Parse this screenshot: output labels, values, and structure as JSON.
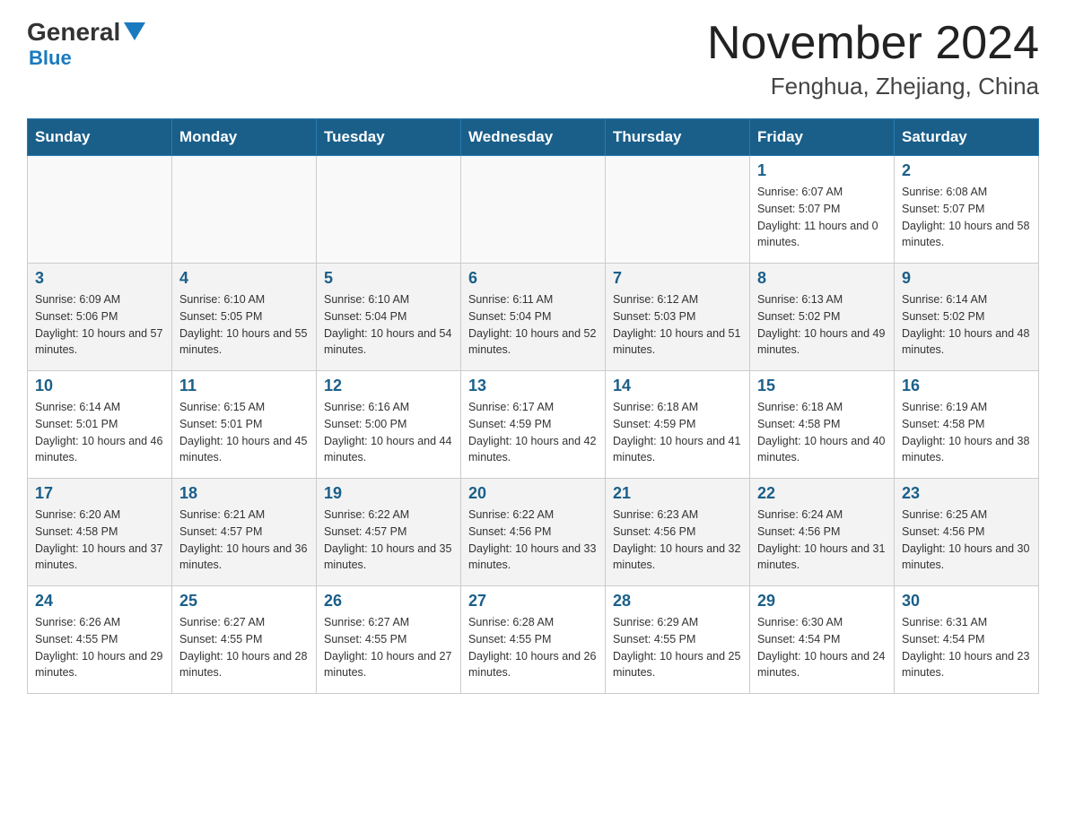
{
  "header": {
    "logo_general": "General",
    "logo_blue": "Blue",
    "title": "November 2024",
    "subtitle": "Fenghua, Zhejiang, China"
  },
  "days_of_week": [
    "Sunday",
    "Monday",
    "Tuesday",
    "Wednesday",
    "Thursday",
    "Friday",
    "Saturday"
  ],
  "weeks": [
    [
      {
        "day": "",
        "info": ""
      },
      {
        "day": "",
        "info": ""
      },
      {
        "day": "",
        "info": ""
      },
      {
        "day": "",
        "info": ""
      },
      {
        "day": "",
        "info": ""
      },
      {
        "day": "1",
        "info": "Sunrise: 6:07 AM\nSunset: 5:07 PM\nDaylight: 11 hours and 0 minutes."
      },
      {
        "day": "2",
        "info": "Sunrise: 6:08 AM\nSunset: 5:07 PM\nDaylight: 10 hours and 58 minutes."
      }
    ],
    [
      {
        "day": "3",
        "info": "Sunrise: 6:09 AM\nSunset: 5:06 PM\nDaylight: 10 hours and 57 minutes."
      },
      {
        "day": "4",
        "info": "Sunrise: 6:10 AM\nSunset: 5:05 PM\nDaylight: 10 hours and 55 minutes."
      },
      {
        "day": "5",
        "info": "Sunrise: 6:10 AM\nSunset: 5:04 PM\nDaylight: 10 hours and 54 minutes."
      },
      {
        "day": "6",
        "info": "Sunrise: 6:11 AM\nSunset: 5:04 PM\nDaylight: 10 hours and 52 minutes."
      },
      {
        "day": "7",
        "info": "Sunrise: 6:12 AM\nSunset: 5:03 PM\nDaylight: 10 hours and 51 minutes."
      },
      {
        "day": "8",
        "info": "Sunrise: 6:13 AM\nSunset: 5:02 PM\nDaylight: 10 hours and 49 minutes."
      },
      {
        "day": "9",
        "info": "Sunrise: 6:14 AM\nSunset: 5:02 PM\nDaylight: 10 hours and 48 minutes."
      }
    ],
    [
      {
        "day": "10",
        "info": "Sunrise: 6:14 AM\nSunset: 5:01 PM\nDaylight: 10 hours and 46 minutes."
      },
      {
        "day": "11",
        "info": "Sunrise: 6:15 AM\nSunset: 5:01 PM\nDaylight: 10 hours and 45 minutes."
      },
      {
        "day": "12",
        "info": "Sunrise: 6:16 AM\nSunset: 5:00 PM\nDaylight: 10 hours and 44 minutes."
      },
      {
        "day": "13",
        "info": "Sunrise: 6:17 AM\nSunset: 4:59 PM\nDaylight: 10 hours and 42 minutes."
      },
      {
        "day": "14",
        "info": "Sunrise: 6:18 AM\nSunset: 4:59 PM\nDaylight: 10 hours and 41 minutes."
      },
      {
        "day": "15",
        "info": "Sunrise: 6:18 AM\nSunset: 4:58 PM\nDaylight: 10 hours and 40 minutes."
      },
      {
        "day": "16",
        "info": "Sunrise: 6:19 AM\nSunset: 4:58 PM\nDaylight: 10 hours and 38 minutes."
      }
    ],
    [
      {
        "day": "17",
        "info": "Sunrise: 6:20 AM\nSunset: 4:58 PM\nDaylight: 10 hours and 37 minutes."
      },
      {
        "day": "18",
        "info": "Sunrise: 6:21 AM\nSunset: 4:57 PM\nDaylight: 10 hours and 36 minutes."
      },
      {
        "day": "19",
        "info": "Sunrise: 6:22 AM\nSunset: 4:57 PM\nDaylight: 10 hours and 35 minutes."
      },
      {
        "day": "20",
        "info": "Sunrise: 6:22 AM\nSunset: 4:56 PM\nDaylight: 10 hours and 33 minutes."
      },
      {
        "day": "21",
        "info": "Sunrise: 6:23 AM\nSunset: 4:56 PM\nDaylight: 10 hours and 32 minutes."
      },
      {
        "day": "22",
        "info": "Sunrise: 6:24 AM\nSunset: 4:56 PM\nDaylight: 10 hours and 31 minutes."
      },
      {
        "day": "23",
        "info": "Sunrise: 6:25 AM\nSunset: 4:56 PM\nDaylight: 10 hours and 30 minutes."
      }
    ],
    [
      {
        "day": "24",
        "info": "Sunrise: 6:26 AM\nSunset: 4:55 PM\nDaylight: 10 hours and 29 minutes."
      },
      {
        "day": "25",
        "info": "Sunrise: 6:27 AM\nSunset: 4:55 PM\nDaylight: 10 hours and 28 minutes."
      },
      {
        "day": "26",
        "info": "Sunrise: 6:27 AM\nSunset: 4:55 PM\nDaylight: 10 hours and 27 minutes."
      },
      {
        "day": "27",
        "info": "Sunrise: 6:28 AM\nSunset: 4:55 PM\nDaylight: 10 hours and 26 minutes."
      },
      {
        "day": "28",
        "info": "Sunrise: 6:29 AM\nSunset: 4:55 PM\nDaylight: 10 hours and 25 minutes."
      },
      {
        "day": "29",
        "info": "Sunrise: 6:30 AM\nSunset: 4:54 PM\nDaylight: 10 hours and 24 minutes."
      },
      {
        "day": "30",
        "info": "Sunrise: 6:31 AM\nSunset: 4:54 PM\nDaylight: 10 hours and 23 minutes."
      }
    ]
  ]
}
